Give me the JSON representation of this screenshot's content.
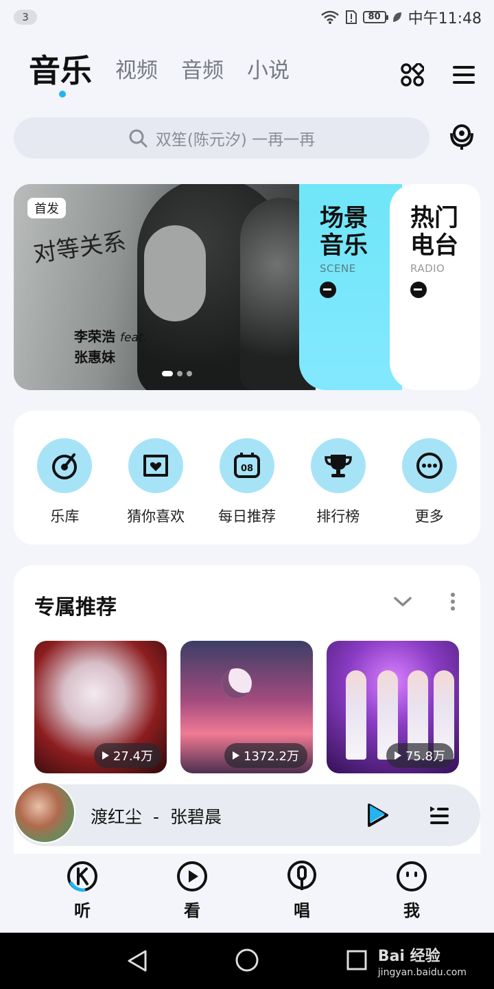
{
  "status_bar": {
    "notification_count": "3",
    "battery": "80",
    "time": "中午11:48"
  },
  "tabs": [
    {
      "label": "音乐",
      "active": true
    },
    {
      "label": "视频",
      "active": false
    },
    {
      "label": "音频",
      "active": false
    },
    {
      "label": "小说",
      "active": false
    }
  ],
  "header_icons": [
    "apps-grid-icon",
    "menu-icon"
  ],
  "search": {
    "placeholder": "双笙(陈元汐) 一再一再"
  },
  "banner": {
    "badge": "首发",
    "credit_line1": "李荣浩",
    "credit_feat": "feat.",
    "credit_line2": "张惠妹",
    "handwritten_title": "对等关系",
    "scene": {
      "title_line1": "场景",
      "title_line2": "音乐",
      "subtitle": "SCENE"
    },
    "radio": {
      "title_line1": "热门",
      "title_line2": "电台",
      "subtitle": "RADIO"
    }
  },
  "quick_entries": [
    {
      "label": "乐库",
      "icon": "music-library-icon"
    },
    {
      "label": "猜你喜欢",
      "icon": "heart-box-icon"
    },
    {
      "label": "每日推荐",
      "icon": "calendar-08-icon",
      "icon_text": "08"
    },
    {
      "label": "排行榜",
      "icon": "trophy-icon"
    },
    {
      "label": "更多",
      "icon": "more-dots-icon"
    }
  ],
  "recommend": {
    "title": "专属推荐",
    "cards": [
      {
        "play_count": "27.4万"
      },
      {
        "play_count": "1372.2万"
      },
      {
        "play_count": "75.8万"
      }
    ]
  },
  "player": {
    "song": "渡红尘",
    "separator": "-",
    "artist": "张碧晨"
  },
  "bottom_nav": [
    {
      "label": "听",
      "icon": "listen-k-icon"
    },
    {
      "label": "看",
      "icon": "watch-play-icon"
    },
    {
      "label": "唱",
      "icon": "sing-mic-icon"
    },
    {
      "label": "我",
      "icon": "me-face-icon"
    }
  ],
  "watermark": {
    "brand": "Bai 经验",
    "url": "jingyan.baidu.com"
  },
  "colors": {
    "accent": "#23b4f2",
    "icon_bg": "#a6e3f7",
    "scene_bg": "#6fe6f7"
  }
}
